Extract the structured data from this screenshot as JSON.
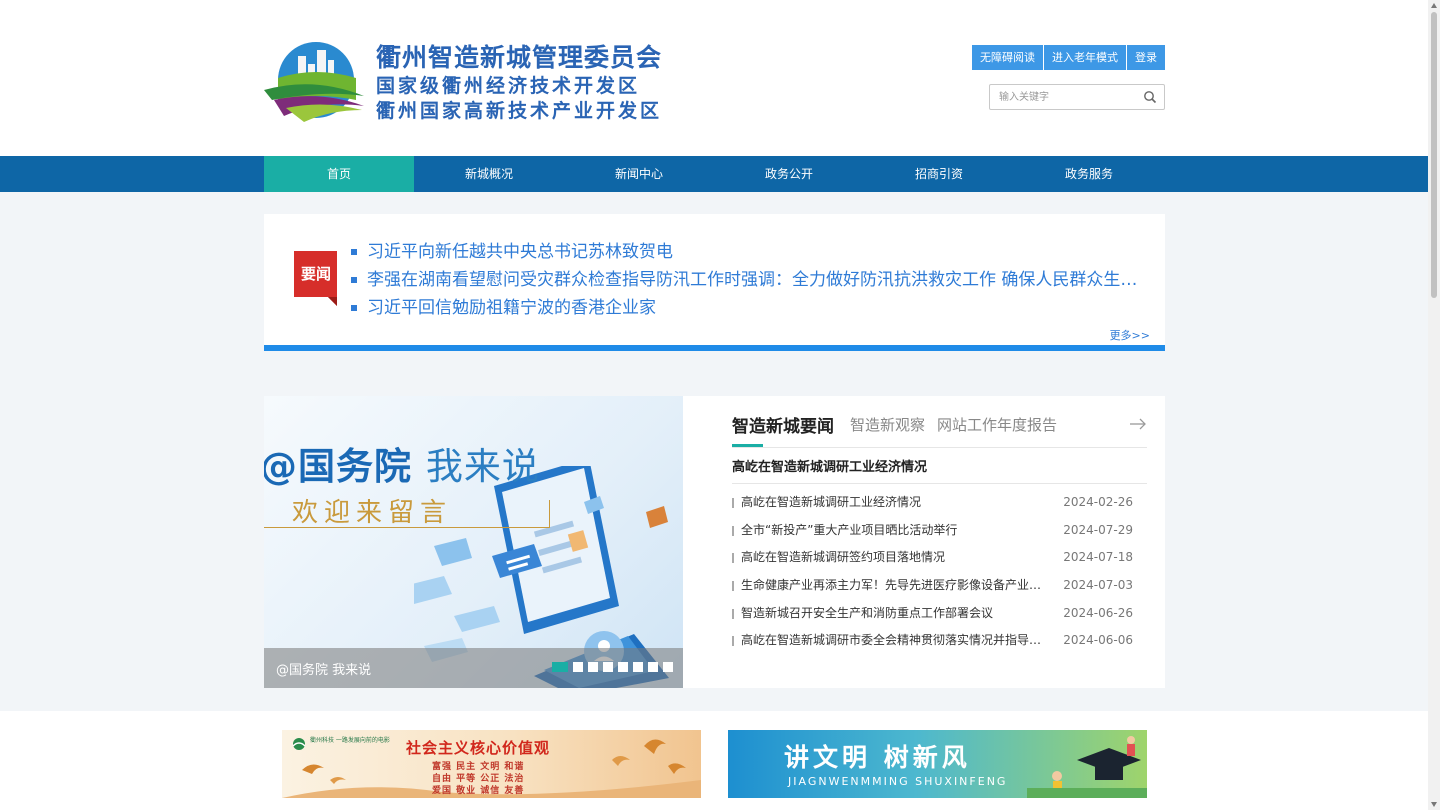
{
  "header": {
    "logo_line1": "衢州智造新城管理委员会",
    "logo_line2": "国家级衢州经济技术开发区",
    "logo_line3": "衢州国家高新技术产业开发区",
    "buttons": [
      "无障碍阅读",
      "进入老年模式",
      "登录"
    ],
    "search_placeholder": "输入关键字"
  },
  "nav": {
    "items": [
      "首页",
      "新城概况",
      "新闻中心",
      "政务公开",
      "招商引资",
      "政务服务"
    ],
    "active_index": 0
  },
  "top_news": {
    "badge": "要闻",
    "headlines": [
      "习近平向新任越共中央总书记苏林致贺电",
      "李强在湖南看望慰问受灾群众检查指导防汛工作时强调：全力做好防汛抗洪救灾工作 确保人民群众生命…",
      "习近平回信勉励祖籍宁波的香港企业家"
    ],
    "more": "更多>>"
  },
  "slider": {
    "title_bold": "@国务院",
    "title_thin": "我来说",
    "subtitle": "欢迎来留言",
    "caption": "@国务院 我来说",
    "dot_count": 8,
    "active_dot": 0
  },
  "news_panel": {
    "tabs": [
      "智造新城要闻",
      "智造新观察",
      "网站工作年度报告"
    ],
    "active_tab": 0,
    "featured": "高屹在智造新城调研工业经济情况",
    "items": [
      {
        "title": "高屹在智造新城调研工业经济情况",
        "date": "2024-02-26"
      },
      {
        "title": "全市“新投产”重大产业项目晒比活动举行",
        "date": "2024-07-29"
      },
      {
        "title": "高屹在智造新城调研签约项目落地情况",
        "date": "2024-07-18"
      },
      {
        "title": "生命健康产业再添主力军！先导先进医疗影像设备产业…",
        "date": "2024-07-03"
      },
      {
        "title": "智造新城召开安全生产和消防重点工作部署会议",
        "date": "2024-06-26"
      },
      {
        "title": "高屹在智造新城调研市委全会精神贯彻落实情况并指导…",
        "date": "2024-06-06"
      }
    ]
  },
  "banners": {
    "left": {
      "brand": "衢州科技 一路发展向前的电影",
      "title": "社会主义核心价值观",
      "line1": "富强  民主  文明  和谐",
      "line2": "自由  平等  公正  法治",
      "line3": "爱国  敬业  诚信  友善"
    },
    "right": {
      "title": "讲文明 树新风",
      "subtitle": "JIAGNWENMMING  SHUXINFENG"
    }
  },
  "colors": {
    "nav_bg": "#0e66a6",
    "nav_active": "#1aaea5",
    "accent_blue": "#1f8be8",
    "headline_blue": "#2f7bd6",
    "top_button": "#3d98e6"
  }
}
